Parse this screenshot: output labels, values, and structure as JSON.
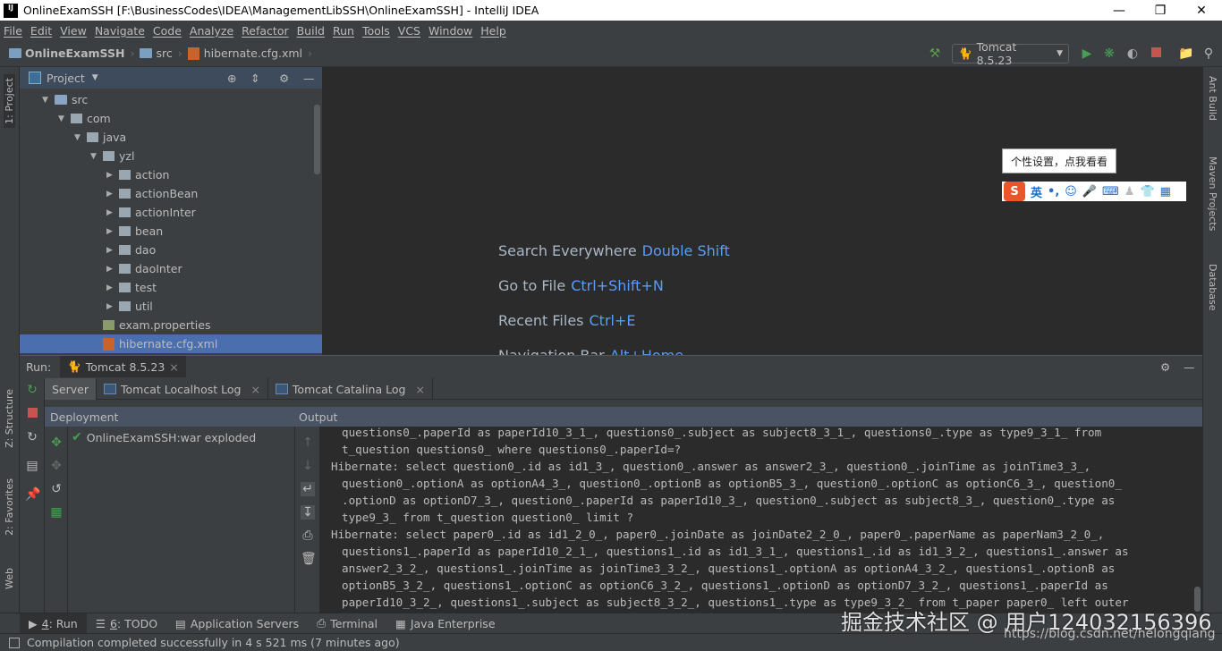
{
  "window": {
    "title": "OnlineExamSSH [F:\\BusinessCodes\\IDEA\\ManagementLibSSH\\OnlineExamSSH] - IntelliJ IDEA",
    "logo": "IJ",
    "controls": [
      "minimize",
      "restore",
      "close"
    ]
  },
  "menu": [
    "File",
    "Edit",
    "View",
    "Navigate",
    "Code",
    "Analyze",
    "Refactor",
    "Build",
    "Run",
    "Tools",
    "VCS",
    "Window",
    "Help"
  ],
  "breadcrumb": [
    "OnlineExamSSH",
    "src",
    "hibernate.cfg.xml"
  ],
  "toolbar": {
    "run_config": "Tomcat 8.5.23",
    "icons": [
      "hammer-icon",
      "run-icon",
      "debug-icon",
      "coverage-icon",
      "stop-icon",
      "project-structure-icon",
      "search-icon"
    ]
  },
  "left_stripe": {
    "project": "1: Project",
    "structure": "Z: Structure",
    "favorites": "2: Favorites",
    "web": "Web"
  },
  "right_stripe": {
    "ant": "Ant Build",
    "maven": "Maven Projects",
    "database": "Database"
  },
  "project": {
    "title": "Project",
    "tree": [
      {
        "label": "src",
        "type": "folder",
        "depth": 0,
        "arrow": "open"
      },
      {
        "label": "com",
        "type": "package",
        "depth": 1,
        "arrow": "open"
      },
      {
        "label": "java",
        "type": "package",
        "depth": 2,
        "arrow": "open"
      },
      {
        "label": "yzl",
        "type": "package",
        "depth": 3,
        "arrow": "open"
      },
      {
        "label": "action",
        "type": "package",
        "depth": 4,
        "arrow": "closed"
      },
      {
        "label": "actionBean",
        "type": "package",
        "depth": 4,
        "arrow": "closed"
      },
      {
        "label": "actionInter",
        "type": "package",
        "depth": 4,
        "arrow": "closed"
      },
      {
        "label": "bean",
        "type": "package",
        "depth": 4,
        "arrow": "closed"
      },
      {
        "label": "dao",
        "type": "package",
        "depth": 4,
        "arrow": "closed"
      },
      {
        "label": "daoInter",
        "type": "package",
        "depth": 4,
        "arrow": "closed"
      },
      {
        "label": "test",
        "type": "package",
        "depth": 4,
        "arrow": "closed"
      },
      {
        "label": "util",
        "type": "package",
        "depth": 4,
        "arrow": "closed"
      },
      {
        "label": "exam.properties",
        "type": "file",
        "depth": 3,
        "arrow": "none"
      },
      {
        "label": "hibernate.cfg.xml",
        "type": "xml",
        "depth": 3,
        "arrow": "none",
        "selected": true
      }
    ]
  },
  "editor": {
    "hints": [
      {
        "label": "Search Everywhere",
        "key": "Double Shift"
      },
      {
        "label": "Go to File",
        "key": "Ctrl+Shift+N"
      },
      {
        "label": "Recent Files",
        "key": "Ctrl+E"
      },
      {
        "label": "Navigation Bar",
        "key": "Alt+Home"
      }
    ]
  },
  "ime": {
    "tooltip": "个性设置，点我看看",
    "mode": "英",
    "punct": "•,"
  },
  "run": {
    "label": "Run:",
    "tab": "Tomcat 8.5.23",
    "subtabs": [
      {
        "label": "Server"
      },
      {
        "label": "Tomcat Localhost Log"
      },
      {
        "label": "Tomcat Catalina Log"
      }
    ],
    "deployment_header": "Deployment",
    "output_header": "Output",
    "deployment_item": "OnlineExamSSH:war exploded",
    "output": [
      {
        "text": "questions0_.paperId as paperId10_3_1_, questions0_.subject as subject8_3_1_, questions0_.type as type9_3_1_ from",
        "indent": true
      },
      {
        "text": "t_question questions0_ where questions0_.paperId=?",
        "indent": true
      },
      {
        "text": "Hibernate: select question0_.id as id1_3_, question0_.answer as answer2_3_, question0_.joinTime as joinTime3_3_,",
        "indent": false
      },
      {
        "text": "question0_.optionA as optionA4_3_, question0_.optionB as optionB5_3_, question0_.optionC as optionC6_3_, question0_",
        "indent": true
      },
      {
        "text": ".optionD as optionD7_3_, question0_.paperId as paperId10_3_, question0_.subject as subject8_3_, question0_.type as",
        "indent": true
      },
      {
        "text": "type9_3_ from t_question question0_ limit ?",
        "indent": true
      },
      {
        "text": "Hibernate: select paper0_.id as id1_2_0_, paper0_.joinDate as joinDate2_2_0_, paper0_.paperName as paperNam3_2_0_,",
        "indent": false
      },
      {
        "text": "questions1_.paperId as paperId10_2_1_, questions1_.id as id1_3_1_, questions1_.id as id1_3_2_, questions1_.answer as",
        "indent": true
      },
      {
        "text": "answer2_3_2_, questions1_.joinTime as joinTime3_3_2_, questions1_.optionA as optionA4_3_2_, questions1_.optionB as",
        "indent": true
      },
      {
        "text": "optionB5_3_2_, questions1_.optionC as optionC6_3_2_, questions1_.optionD as optionD7_3_2_, questions1_.paperId as",
        "indent": true
      },
      {
        "text": "paperId10_3_2_, questions1_.subject as subject8_3_2_, questions1_.type as type9_3_2_ from t_paper paper0_ left outer",
        "indent": true
      }
    ]
  },
  "bottom_tabs": [
    {
      "key": "4",
      "label": ": Run"
    },
    {
      "key": "6",
      "label": ": TODO"
    },
    {
      "key": "",
      "label": "Application Servers"
    },
    {
      "key": "",
      "label": "Terminal"
    },
    {
      "key": "",
      "label": "Java Enterprise"
    }
  ],
  "status": "Compilation completed successfully in 4 s 521 ms (7 minutes ago)",
  "watermark": {
    "text": "掘金技术社区 @ 用户1240321563​96",
    "url": "https://blog.csdn.net/helongqiang"
  },
  "colors": {
    "accent": "#589df6",
    "editor_bg": "#2b2b2b",
    "panel_bg": "#3c3f41",
    "selection": "#4b6eaf",
    "run_green": "#499c54",
    "stop_red": "#c75450"
  }
}
